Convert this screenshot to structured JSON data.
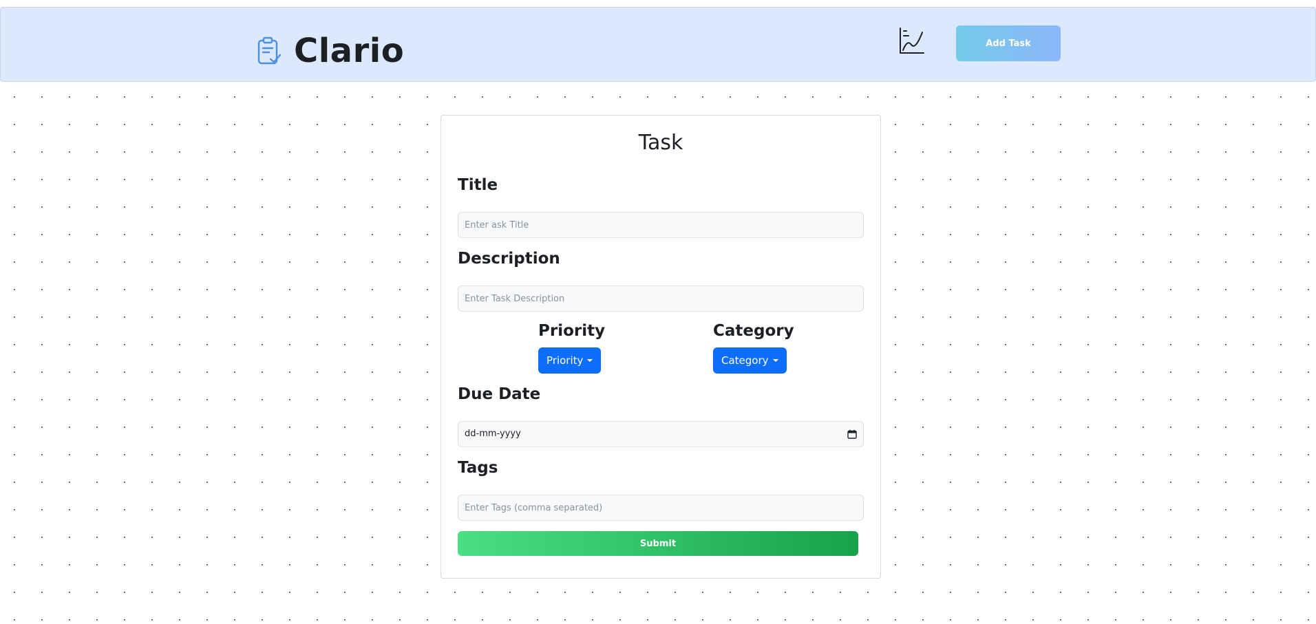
{
  "header": {
    "app_name": "Clario",
    "add_task_label": "Add Task",
    "accent_gradient": [
      "#74cbe9",
      "#8cb6fb"
    ],
    "logo_icon": "clipboard-check-icon",
    "analytics_icon": "line-chart-icon"
  },
  "form": {
    "title": "Task",
    "title_label": "Title",
    "title_placeholder": "Enter ask Title",
    "description_label": "Description",
    "description_placeholder": "Enter Task Description",
    "priority_label": "Priority",
    "priority_button": "Priority",
    "category_label": "Category",
    "category_button": "Category",
    "due_date_label": "Due Date",
    "due_date_value": "dd-mm-yyyy",
    "tags_label": "Tags",
    "tags_placeholder": "Enter Tags (comma separated)",
    "submit_label": "Submit",
    "primary_color": "#0d6efd",
    "submit_gradient": [
      "#4cde82",
      "#16a34a"
    ]
  }
}
